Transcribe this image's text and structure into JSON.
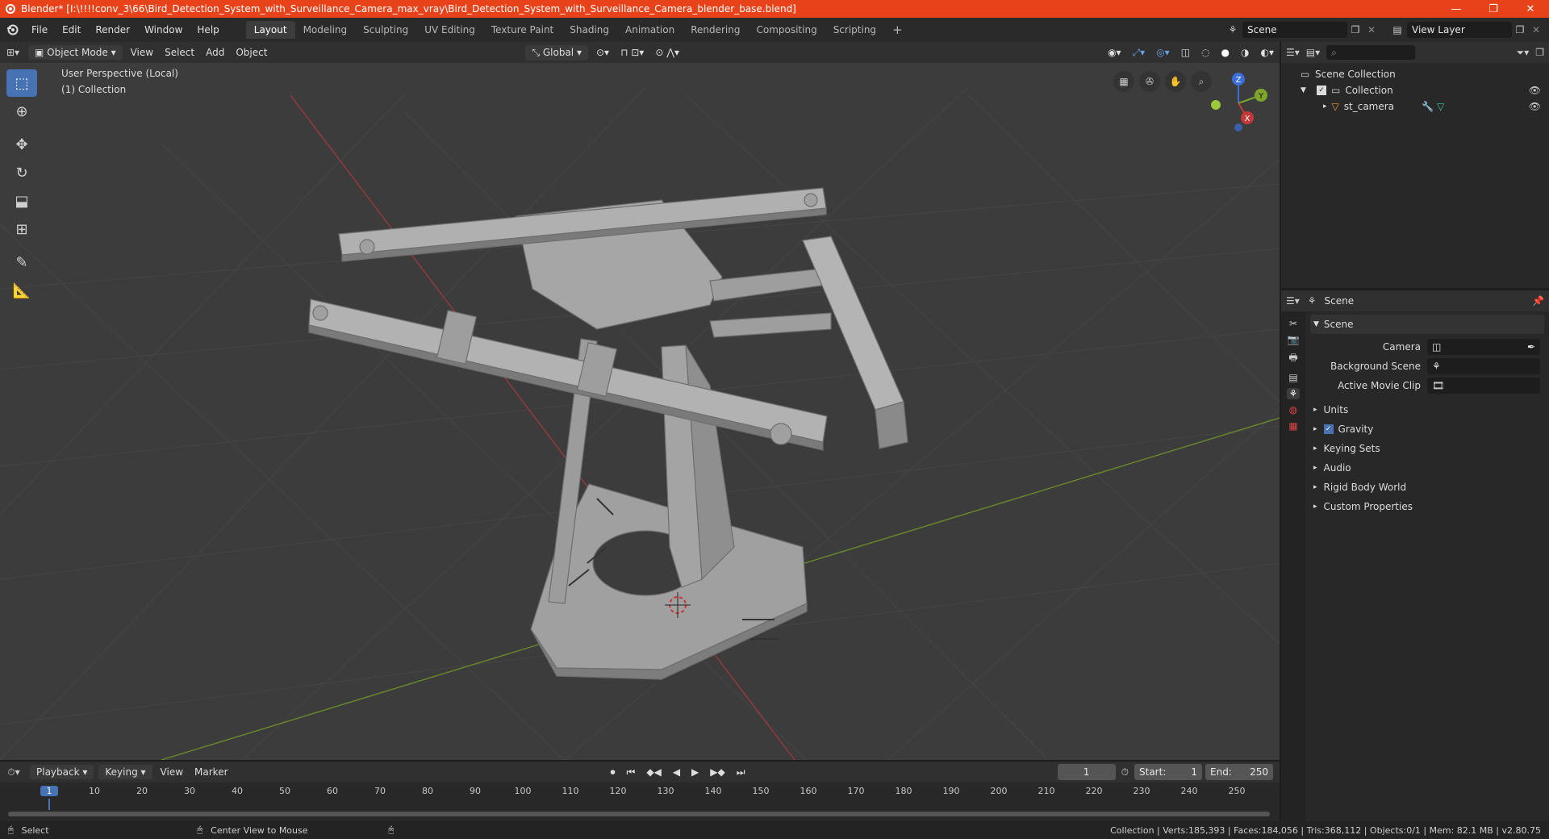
{
  "window": {
    "title": "Blender* [I:\\!!!!conv_3\\66\\Bird_Detection_System_with_Surveillance_Camera_max_vray\\Bird_Detection_System_with_Surveillance_Camera_blender_base.blend]",
    "minimize": "—",
    "maximize": "❐",
    "close": "✕"
  },
  "menu": [
    "File",
    "Edit",
    "Render",
    "Window",
    "Help"
  ],
  "workspaces": [
    "Layout",
    "Modeling",
    "Sculpting",
    "UV Editing",
    "Texture Paint",
    "Shading",
    "Animation",
    "Rendering",
    "Compositing",
    "Scripting"
  ],
  "active_workspace": "Layout",
  "scene_field": "Scene",
  "view_layer_field": "View Layer",
  "viewport_header": {
    "mode": "Object Mode",
    "items": [
      "View",
      "Select",
      "Add",
      "Object"
    ],
    "transform_orientation": "Global"
  },
  "viewport": {
    "perspective_label": "User Perspective (Local)",
    "collection_label": "(1) Collection",
    "gizmo": {
      "z": "Z",
      "y": "Y",
      "x": "X"
    }
  },
  "outliner": {
    "root": "Scene Collection",
    "collection": "Collection",
    "object": "st_camera"
  },
  "properties": {
    "header": "Scene",
    "panel": "Scene",
    "fields": [
      {
        "label": "Camera",
        "value": ""
      },
      {
        "label": "Background Scene",
        "value": ""
      },
      {
        "label": "Active Movie Clip",
        "value": ""
      }
    ],
    "sections": [
      "Units",
      "Gravity",
      "Keying Sets",
      "Audio",
      "Rigid Body World",
      "Custom Properties"
    ],
    "gravity_checked": true
  },
  "timeline": {
    "menus": [
      "Playback",
      "Keying",
      "View",
      "Marker"
    ],
    "current_frame": "1",
    "start_label": "Start:",
    "start": "1",
    "end_label": "End:",
    "end": "250",
    "ticks": [
      "1",
      "10",
      "20",
      "30",
      "40",
      "50",
      "60",
      "70",
      "80",
      "90",
      "100",
      "110",
      "120",
      "130",
      "140",
      "150",
      "160",
      "170",
      "180",
      "190",
      "200",
      "210",
      "220",
      "230",
      "240",
      "250"
    ]
  },
  "statusbar": {
    "select": "Select",
    "center_view": "Center View to Mouse",
    "stats": "Collection | Verts:185,393 | Faces:184,056 | Tris:368,112 | Objects:0/1 | Mem: 82.1 MB | v2.80.75"
  },
  "colors": {
    "title_bar": "#e8421a",
    "accent": "#4772b3",
    "axis_x": "#c5383a",
    "axis_y": "#7fa62a"
  }
}
